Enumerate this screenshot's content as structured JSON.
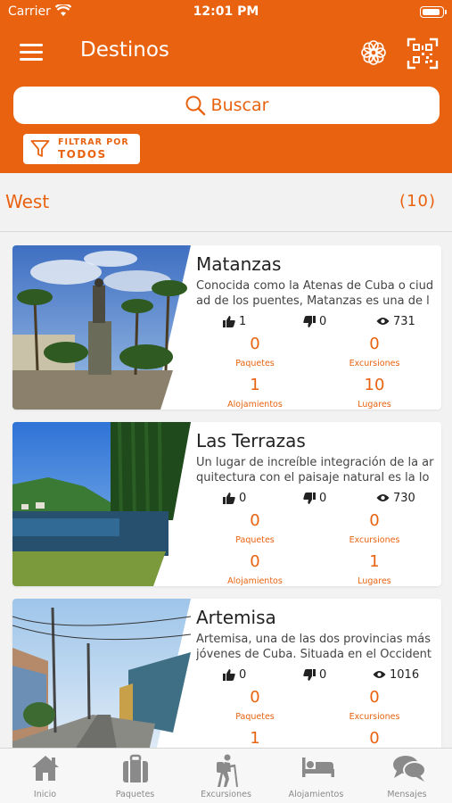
{
  "status_bar": {
    "carrier": "Carrier",
    "time": "12:01 PM"
  },
  "header": {
    "title": "Destinos"
  },
  "search": {
    "placeholder": "Buscar"
  },
  "filter": {
    "line1": "FILTRAR POR",
    "line2": "TODOS"
  },
  "section": {
    "title": "West",
    "count": "(10)"
  },
  "destinations": [
    {
      "name": "Matanzas",
      "description": "Conocida como la Atenas de Cuba o ciudad de los puentes, Matanzas es una de las ci",
      "likes": "1",
      "dislikes": "0",
      "views": "731",
      "paquetes": "0",
      "excursiones": "0",
      "alojamientos": "1",
      "lugares": "10"
    },
    {
      "name": "Las Terrazas",
      "description": "Un lugar de increíble integración de la arquitectura con el paisaje natural es la localidad",
      "likes": "0",
      "dislikes": "0",
      "views": "730",
      "paquetes": "0",
      "excursiones": "0",
      "alojamientos": "0",
      "lugares": "1"
    },
    {
      "name": "Artemisa",
      "description": "Artemisa, una de las dos provincias más jóvenes de Cuba. Situada en el Occidente de l",
      "likes": "0",
      "dislikes": "0",
      "views": "1016",
      "paquetes": "0",
      "excursiones": "0",
      "alojamientos": "1",
      "lugares": "0"
    }
  ],
  "labels": {
    "paquetes": "Paquetes",
    "excursiones": "Excursiones",
    "alojamientos": "Alojamientos",
    "lugares": "Lugares"
  },
  "tabs": [
    {
      "label": "Inicio",
      "icon": "home-icon"
    },
    {
      "label": "Paquetes",
      "icon": "luggage-icon"
    },
    {
      "label": "Excursiones",
      "icon": "hiker-icon"
    },
    {
      "label": "Alojamientos",
      "icon": "bed-icon"
    },
    {
      "label": "Mensajes",
      "icon": "chat-icon"
    }
  ],
  "colors": {
    "accent": "#e8620f",
    "tab_icon": "#8a8a8a"
  }
}
